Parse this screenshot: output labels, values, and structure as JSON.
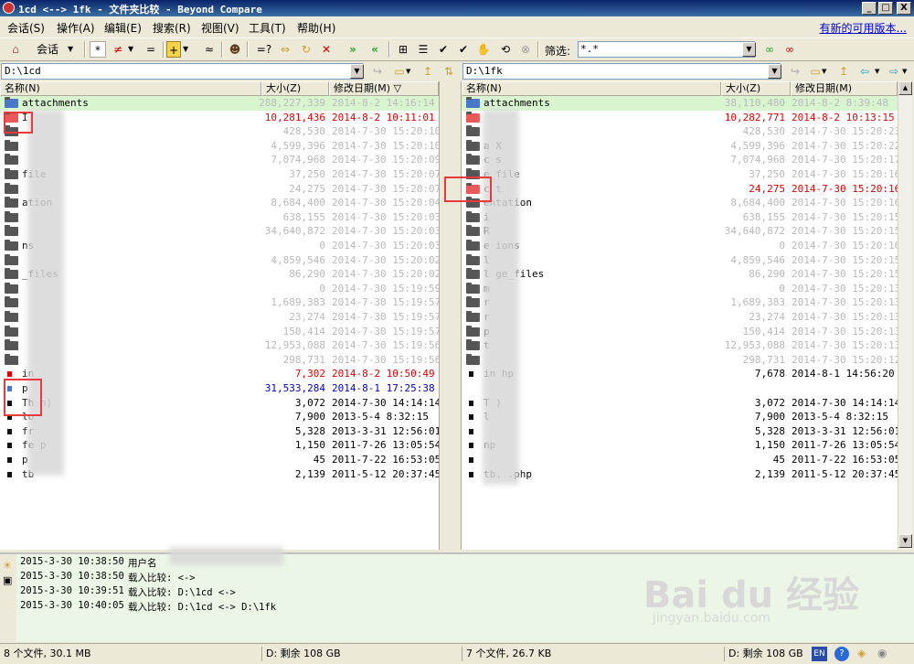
{
  "window": {
    "title": "1cd <--> 1fk - 文件夹比较 - Beyond Compare",
    "min_label": "_",
    "max_label": "□",
    "close_label": "X"
  },
  "menu": {
    "items": [
      "会话(S)",
      "操作(A)",
      "编辑(E)",
      "搜索(R)",
      "视图(V)",
      "工具(T)",
      "帮助(H)"
    ],
    "update_link": "有新的可用版本..."
  },
  "toolbar": {
    "session_label": "会话",
    "all_label": "*",
    "diff_label": "≠",
    "same_label": "=",
    "approx_label": "≈",
    "compare_label": "=?",
    "filter_label": "筛选:",
    "filter_value": "*.*"
  },
  "left_pane": {
    "path": "D:\\1cd",
    "headers": {
      "name": "名称(N)",
      "size": "大小(Z)",
      "date": "修改日期(M) ▽"
    },
    "rows": [
      {
        "type": "folder",
        "status": "same",
        "name": "attachments",
        "size": "288,227,339",
        "date": "2014-8-2 14:16:14",
        "hl": true
      },
      {
        "type": "folder",
        "status": "diff",
        "name": "I",
        "size": "10,281,436",
        "date": "2014-8-2 10:11:01"
      },
      {
        "type": "folder",
        "status": "same",
        "name": "",
        "size": "428,530",
        "date": "2014-7-30 15:20:10"
      },
      {
        "type": "folder",
        "status": "same",
        "name": "",
        "size": "4,599,396",
        "date": "2014-7-30 15:20:10"
      },
      {
        "type": "folder",
        "status": "same",
        "name": "",
        "size": "7,074,968",
        "date": "2014-7-30 15:20:09"
      },
      {
        "type": "folder",
        "status": "same",
        "name": "file",
        "size": "37,250",
        "date": "2014-7-30 15:20:07"
      },
      {
        "type": "folder",
        "status": "same",
        "name": "",
        "size": "24,275",
        "date": "2014-7-30 15:20:07"
      },
      {
        "type": "folder",
        "status": "same",
        "name": "ation",
        "size": "8,684,400",
        "date": "2014-7-30 15:20:04"
      },
      {
        "type": "folder",
        "status": "same",
        "name": "",
        "size": "638,155",
        "date": "2014-7-30 15:20:03"
      },
      {
        "type": "folder",
        "status": "same",
        "name": "",
        "size": "34,640,872",
        "date": "2014-7-30 15:20:03"
      },
      {
        "type": "folder",
        "status": "same",
        "name": "ns",
        "size": "0",
        "date": "2014-7-30 15:20:03"
      },
      {
        "type": "folder",
        "status": "same",
        "name": "",
        "size": "4,859,546",
        "date": "2014-7-30 15:20:02"
      },
      {
        "type": "folder",
        "status": "same",
        "name": "_files",
        "size": "86,290",
        "date": "2014-7-30 15:20:02"
      },
      {
        "type": "folder",
        "status": "same",
        "name": "",
        "size": "0",
        "date": "2014-7-30 15:19:59"
      },
      {
        "type": "folder",
        "status": "same",
        "name": "",
        "size": "1,689,383",
        "date": "2014-7-30 15:19:57"
      },
      {
        "type": "folder",
        "status": "same",
        "name": "",
        "size": "23,274",
        "date": "2014-7-30 15:19:57"
      },
      {
        "type": "folder",
        "status": "same",
        "name": "",
        "size": "150,414",
        "date": "2014-7-30 15:19:57"
      },
      {
        "type": "folder",
        "status": "same",
        "name": "",
        "size": "12,953,088",
        "date": "2014-7-30 15:19:56"
      },
      {
        "type": "folder",
        "status": "same",
        "name": "",
        "size": "298,731",
        "date": "2014-7-30 15:19:56"
      },
      {
        "type": "file",
        "status": "diff",
        "name": "in",
        "size": "7,302",
        "date": "2014-8-2 10:50:49"
      },
      {
        "type": "file",
        "status": "orphan",
        "name": "p",
        "size": "31,533,284",
        "date": "2014-8-1 17:25:38"
      },
      {
        "type": "file",
        "status": "plain",
        "name": "Th              h)",
        "size": "3,072",
        "date": "2014-7-30 14:14:14"
      },
      {
        "type": "file",
        "status": "plain",
        "name": "lo",
        "size": "7,900",
        "date": "2013-5-4 8:32:15"
      },
      {
        "type": "file",
        "status": "plain",
        "name": "fr",
        "size": "5,328",
        "date": "2013-3-31 12:56:01"
      },
      {
        "type": "file",
        "status": "plain",
        "name": "fe          p",
        "size": "1,150",
        "date": "2011-7-26 13:05:54"
      },
      {
        "type": "file",
        "status": "plain",
        "name": "p",
        "size": "45",
        "date": "2011-7-22 16:53:05"
      },
      {
        "type": "file",
        "status": "plain",
        "name": "tb",
        "size": "2,139",
        "date": "2011-5-12 20:37:45"
      }
    ]
  },
  "right_pane": {
    "path": "D:\\1fk",
    "headers": {
      "name": "名称(N)",
      "size": "大小(Z)",
      "date": "修改日期(M)"
    },
    "rows": [
      {
        "type": "folder",
        "status": "same",
        "name": "attachments",
        "size": "38,110,480",
        "date": "2014-8-2 8:39:48",
        "hl": true
      },
      {
        "type": "folder",
        "status": "diff",
        "name": "",
        "size": "10,282,771",
        "date": "2014-8-2 10:13:15"
      },
      {
        "type": "folder",
        "status": "same",
        "name": "",
        "size": "428,530",
        "date": "2014-7-30 15:20:23"
      },
      {
        "type": "folder",
        "status": "same",
        "name": "a       X",
        "size": "4,599,396",
        "date": "2014-7-30 15:20:22"
      },
      {
        "type": "folder",
        "status": "same",
        "name": "c     s",
        "size": "7,074,968",
        "date": "2014-7-30 15:20:17"
      },
      {
        "type": "folder",
        "status": "same",
        "name": "   e_file",
        "size": "37,250",
        "date": "2014-7-30 15:20:16"
      },
      {
        "type": "folder",
        "status": "diff",
        "name": "c      t",
        "size": "24,275",
        "date": "2014-7-30 15:20:16"
      },
      {
        "type": "folder",
        "status": "same",
        "name": "    entation",
        "size": "8,684,400",
        "date": "2014-7-30 15:20:16"
      },
      {
        "type": "folder",
        "status": "same",
        "name": "i",
        "size": "638,155",
        "date": "2014-7-30 15:20:15"
      },
      {
        "type": "folder",
        "status": "same",
        "name": "R",
        "size": "34,640,872",
        "date": "2014-7-30 15:20:15"
      },
      {
        "type": "folder",
        "status": "same",
        "name": "e    ions",
        "size": "0",
        "date": "2014-7-30 15:20:16"
      },
      {
        "type": "folder",
        "status": "same",
        "name": "l",
        "size": "4,859,546",
        "date": "2014-7-30 15:20:15"
      },
      {
        "type": "folder",
        "status": "same",
        "name": "l    ge_files",
        "size": "86,290",
        "date": "2014-7-30 15:20:15"
      },
      {
        "type": "folder",
        "status": "same",
        "name": "m",
        "size": "0",
        "date": "2014-7-30 15:20:13"
      },
      {
        "type": "folder",
        "status": "same",
        "name": "r",
        "size": "1,689,383",
        "date": "2014-7-30 15:20:13"
      },
      {
        "type": "folder",
        "status": "same",
        "name": "r",
        "size": "23,274",
        "date": "2014-7-30 15:20:13"
      },
      {
        "type": "folder",
        "status": "same",
        "name": "p",
        "size": "150,414",
        "date": "2014-7-30 15:20:13"
      },
      {
        "type": "folder",
        "status": "same",
        "name": "t",
        "size": "12,953,088",
        "date": "2014-7-30 15:20:13"
      },
      {
        "type": "folder",
        "status": "same",
        "name": "",
        "size": "298,731",
        "date": "2014-7-30 15:20:12"
      },
      {
        "type": "file",
        "status": "plain",
        "name": "in      hp",
        "size": "7,678",
        "date": "2014-8-1 14:56:20"
      },
      {
        "type": "empty",
        "status": "plain",
        "name": "",
        "size": "",
        "date": ""
      },
      {
        "type": "file",
        "status": "plain",
        "name": "T            )",
        "size": "3,072",
        "date": "2014-7-30 14:14:14"
      },
      {
        "type": "file",
        "status": "plain",
        "name": "l",
        "size": "7,900",
        "date": "2013-5-4 8:32:15"
      },
      {
        "type": "file",
        "status": "plain",
        "name": "",
        "size": "5,328",
        "date": "2013-3-31 12:56:01"
      },
      {
        "type": "file",
        "status": "plain",
        "name": "      np",
        "size": "1,150",
        "date": "2011-7-26 13:05:54"
      },
      {
        "type": "file",
        "status": "plain",
        "name": "",
        "size": "45",
        "date": "2011-7-22 16:53:05"
      },
      {
        "type": "file",
        "status": "plain",
        "name": "tb.  .php",
        "size": "2,139",
        "date": "2011-5-12 20:37:45"
      }
    ]
  },
  "log": [
    {
      "time": "2015-3-30 10:38:50",
      "msg": "用户名"
    },
    {
      "time": "2015-3-30 10:38:50",
      "msg": "载入比较:  <->"
    },
    {
      "time": "2015-3-30 10:39:51",
      "msg": "载入比较: D:\\1cd <->"
    },
    {
      "time": "2015-3-30 10:40:05",
      "msg": "载入比较: D:\\1cd <-> D:\\1fk"
    }
  ],
  "status": {
    "left_count": "8 个文件, 30.1 MB",
    "left_free": "D: 剩余 108 GB",
    "right_count": "7 个文件, 26.7 KB",
    "right_free": "D: 剩余 108 GB",
    "lang": "EN"
  },
  "watermark": {
    "big": "Bai du 经验",
    "small": "jingyan.baidu.com"
  }
}
